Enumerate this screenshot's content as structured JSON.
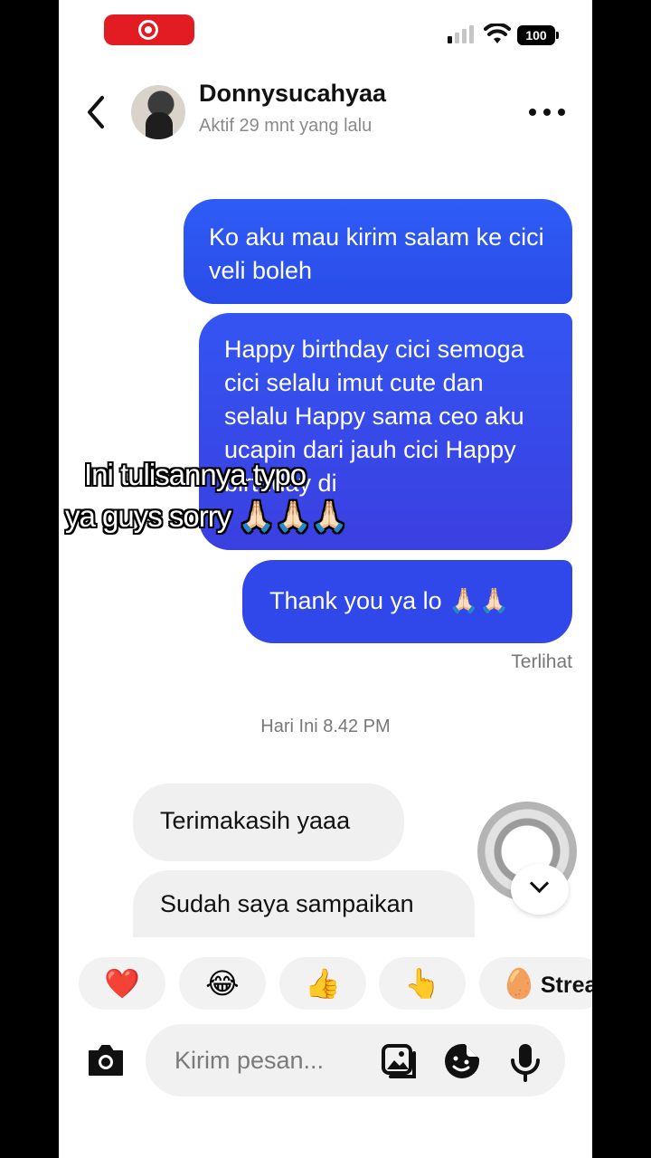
{
  "status_bar": {
    "battery": "100"
  },
  "header": {
    "name": "Donnysucahyaa",
    "status": "Aktif 29 mnt yang lalu"
  },
  "messages": {
    "outgoing": [
      "Ko aku mau kirim salam ke cici veli boleh",
      "Happy birthday cici semoga cici selalu imut cute dan selalu Happy sama ceo aku ucapin dari jauh cici Happy birthday di",
      "Thank you ya lo 🙏🏻🙏🏻"
    ],
    "seen_label": "Terlihat",
    "date_separator": "Hari Ini 8.42 PM",
    "incoming": [
      "Terimakasih yaaa",
      "Sudah saya sampaikan"
    ]
  },
  "quick_reactions": [
    "❤️",
    "😂",
    "👍",
    "👆",
    "🥚"
  ],
  "quick_reaction_label": "Strea",
  "composer": {
    "placeholder": "Kirim pesan..."
  },
  "overlay_caption": {
    "line1": "Ini tulisannya typo",
    "line2": "ya guys sorry 🙏🏻🙏🏻🙏🏻"
  },
  "colors": {
    "accent": "#2f5cf6",
    "record": "#e31b23",
    "incoming_bubble": "#f0f0f0"
  }
}
